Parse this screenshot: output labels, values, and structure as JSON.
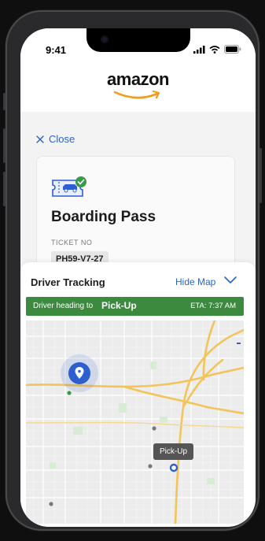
{
  "status_bar": {
    "time": "9:41"
  },
  "header": {
    "logo": "amazon"
  },
  "nav": {
    "close_label": "Close"
  },
  "ticket_card": {
    "title": "Boarding Pass",
    "ticket_label": "TICKET NO",
    "ticket_number": "PH59-V7-27"
  },
  "tracking": {
    "title": "Driver Tracking",
    "hide_map_label": "Hide Map",
    "banner_text": "Driver heading to",
    "banner_destination": "Pick-Up",
    "eta": "ETA: 7:37 AM",
    "pickup_label": "Pick-Up"
  },
  "colors": {
    "accent": "#2a63c8",
    "banner": "#3b8a3e",
    "highway": "#f2c45a",
    "driver_pin": "#2d5fd1"
  }
}
